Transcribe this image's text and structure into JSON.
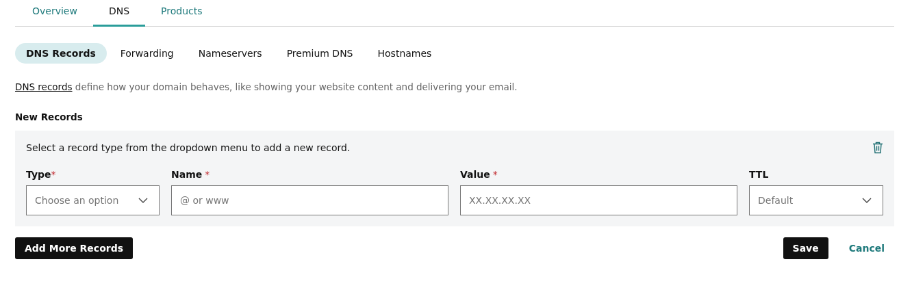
{
  "tabs": [
    {
      "label": "Overview",
      "selected": false
    },
    {
      "label": "DNS",
      "selected": true
    },
    {
      "label": "Products",
      "selected": false
    }
  ],
  "subtabs": [
    {
      "label": "DNS Records",
      "selected": true
    },
    {
      "label": "Forwarding",
      "selected": false
    },
    {
      "label": "Nameservers",
      "selected": false
    },
    {
      "label": "Premium DNS",
      "selected": false
    },
    {
      "label": "Hostnames",
      "selected": false
    }
  ],
  "intro": {
    "link": "DNS records",
    "text": "define how your domain behaves, like showing your website content and delivering your email."
  },
  "section_title": "New Records",
  "record_panel": {
    "instruction": "Select a record type from the dropdown menu to add a new record.",
    "fields": [
      {
        "kind": "select",
        "label": "Type",
        "required_mark": "*",
        "placeholder": "Choose an option"
      },
      {
        "kind": "text",
        "label": "Name",
        "required_mark": "*",
        "placeholder": "@ or www"
      },
      {
        "kind": "text",
        "label": "Value",
        "required_mark": "*",
        "placeholder": "XX.XX.XX.XX"
      },
      {
        "kind": "select",
        "label": "TTL",
        "placeholder": "Default"
      }
    ]
  },
  "add_button": "Add More Records",
  "save_button": "Save",
  "cancel_link": "Cancel"
}
